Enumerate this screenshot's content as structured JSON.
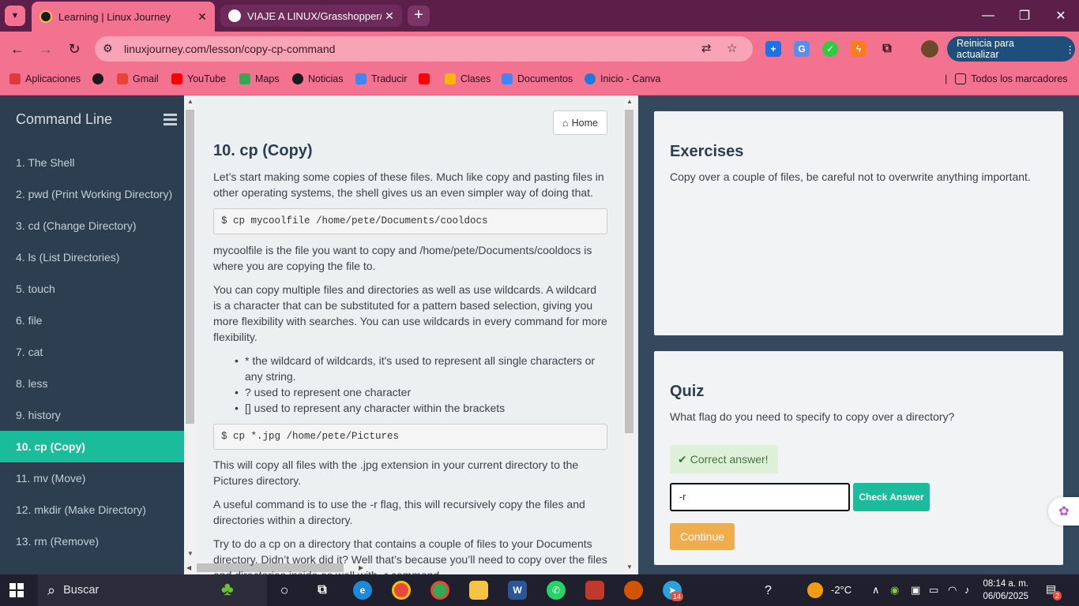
{
  "browser": {
    "tabs": [
      {
        "title": "Learning | Linux Journey",
        "active": true
      },
      {
        "title": "VIAJE A LINUX/Grasshopper/Lin",
        "active": false
      }
    ],
    "close_glyph": "✕",
    "new_tab_glyph": "+",
    "url": "linuxjourney.com/lesson/copy-cp-command",
    "update_label": "Reinicia para actualizar",
    "bookmarks": [
      {
        "label": "Aplicaciones",
        "color": "#e0393e"
      },
      {
        "label": "",
        "color": "#1b1b1b"
      },
      {
        "label": "Gmail",
        "color": "#ea4335"
      },
      {
        "label": "YouTube",
        "color": "#ff0000"
      },
      {
        "label": "Maps",
        "color": "#34a853"
      },
      {
        "label": "Noticias",
        "color": "#1b1b1b"
      },
      {
        "label": "Traducir",
        "color": "#4285f4"
      },
      {
        "label": "",
        "color": "#ff0000"
      },
      {
        "label": "Clases",
        "color": "#f6b60a"
      },
      {
        "label": "Documentos",
        "color": "#4285f4"
      },
      {
        "label": "Inicio - Canva",
        "color": "#1c7ad8"
      }
    ],
    "all_bookmarks": "Todos los marcadores"
  },
  "sidebar": {
    "title": "Command Line",
    "lessons": [
      "1. The Shell",
      "2. pwd (Print Working Directory)",
      "3. cd (Change Directory)",
      "4. ls (List Directories)",
      "5. touch",
      "6. file",
      "7. cat",
      "8. less",
      "9. history",
      "10. cp (Copy)",
      "11. mv (Move)",
      "12. mkdir (Make Directory)",
      "13. rm (Remove)"
    ],
    "active_index": 9
  },
  "lesson": {
    "home_label": "Home",
    "title": "10. cp (Copy)",
    "para1": "Let’s start making some copies of these files. Much like copy and pasting files in other operating systems, the shell gives us an even simpler way of doing that.",
    "code1": "$ cp mycoolfile /home/pete/Documents/cooldocs",
    "para2": "mycoolfile is the file you want to copy and /home/pete/Documents/cooldocs is where you are copying the file to.",
    "para3": "You can copy multiple files and directories as well as use wildcards. A wildcard is a character that can be substituted for a pattern based selection, giving you more flexibility with searches. You can use wildcards in every command for more flexibility.",
    "bullets": [
      "* the wildcard of wildcards, it's used to represent all single characters or any string.",
      "? used to represent one character",
      "[] used to represent any character within the brackets"
    ],
    "code2": "$ cp *.jpg /home/pete/Pictures",
    "para4": "This will copy all files with the .jpg extension in your current directory to the Pictures directory.",
    "para5": "A useful command is to use the -r flag, this will recursively copy the files and directories within a directory.",
    "para6": "Try to do a cp on a directory that contains a couple of files to your Documents directory. Didn’t work did it? Well that’s because you’ll need to copy over the files and directories inside as well with -r command."
  },
  "exercises": {
    "title": "Exercises",
    "text": "Copy over a couple of files, be careful not to overwrite anything important."
  },
  "quiz": {
    "title": "Quiz",
    "question": "What flag do you need to specify to copy over a directory?",
    "feedback": "Correct answer!",
    "answer_value": "-r",
    "check_label": "Check Answer",
    "continue_label": "Continue"
  },
  "taskbar": {
    "search_label": "Buscar",
    "weather": "-2°C",
    "time": "08:14 a. m.",
    "date": "06/06/2025",
    "telegram_badge": "14",
    "notif_badge": "2"
  },
  "colors": {
    "accent": "#1abc9c",
    "browser_pink": "#f3728f",
    "sidebar_bg": "#2c3e50",
    "warning": "#f0ad4e"
  }
}
